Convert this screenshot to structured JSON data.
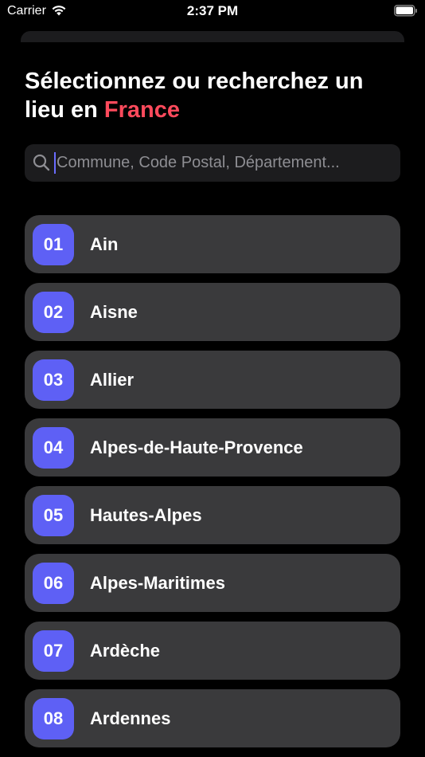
{
  "status_bar": {
    "carrier": "Carrier",
    "time": "2:37 PM"
  },
  "header": {
    "title_prefix": "Sélectionnez ou recherchez un lieu en ",
    "title_accent": "France",
    "accent_color": "#ff4a5c"
  },
  "search": {
    "placeholder": "Commune, Code Postal, Département...",
    "value": "",
    "icon": "search-icon"
  },
  "departments": [
    {
      "code": "01",
      "name": "Ain"
    },
    {
      "code": "02",
      "name": "Aisne"
    },
    {
      "code": "03",
      "name": "Allier"
    },
    {
      "code": "04",
      "name": "Alpes-de-Haute-Provence"
    },
    {
      "code": "05",
      "name": "Hautes-Alpes"
    },
    {
      "code": "06",
      "name": "Alpes-Maritimes"
    },
    {
      "code": "07",
      "name": "Ardèche"
    },
    {
      "code": "08",
      "name": "Ardennes"
    }
  ],
  "colors": {
    "badge": "#5e60f5",
    "row_background": "#3a3a3c",
    "background": "#000000"
  }
}
